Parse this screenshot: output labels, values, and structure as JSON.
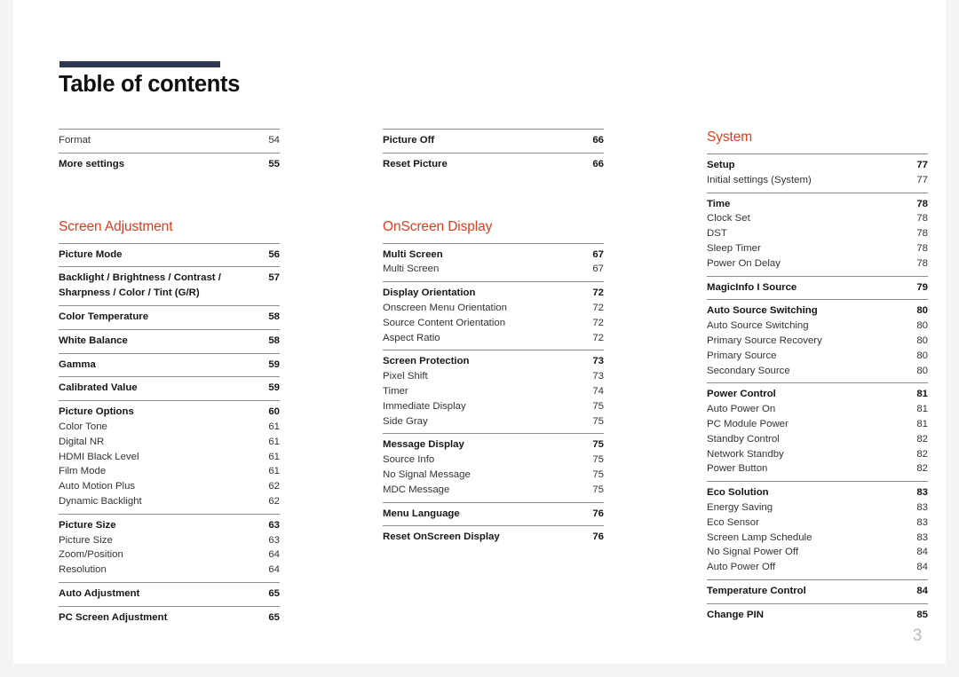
{
  "document": {
    "title": "Table of contents",
    "page_number": "3",
    "accent_color": "#dd3c1d",
    "rule_color": "#2e3852"
  },
  "columns": [
    {
      "name": "column-1",
      "groups": [
        {
          "heading": null,
          "entries": [
            {
              "label": "Format",
              "page": "54",
              "level": "minor"
            }
          ]
        },
        {
          "heading": null,
          "entries": [
            {
              "label": "More settings",
              "page": "55",
              "level": "major"
            }
          ]
        },
        {
          "heading": "Screen Adjustment",
          "entries": [
            {
              "label": "Picture Mode",
              "page": "56",
              "level": "major"
            }
          ]
        },
        {
          "heading": null,
          "entries": [
            {
              "label": "Backlight / Brightness / Contrast / Sharpness / Color / Tint (G/R)",
              "page": "57",
              "level": "major",
              "wrapped": true
            }
          ]
        },
        {
          "heading": null,
          "entries": [
            {
              "label": "Color Temperature",
              "page": "58",
              "level": "major"
            }
          ]
        },
        {
          "heading": null,
          "entries": [
            {
              "label": "White Balance",
              "page": "58",
              "level": "major"
            }
          ]
        },
        {
          "heading": null,
          "entries": [
            {
              "label": "Gamma",
              "page": "59",
              "level": "major"
            }
          ]
        },
        {
          "heading": null,
          "entries": [
            {
              "label": "Calibrated Value",
              "page": "59",
              "level": "major"
            }
          ]
        },
        {
          "heading": null,
          "entries": [
            {
              "label": "Picture Options",
              "page": "60",
              "level": "major"
            },
            {
              "label": "Color Tone",
              "page": "61",
              "level": "minor"
            },
            {
              "label": "Digital NR",
              "page": "61",
              "level": "minor"
            },
            {
              "label": "HDMI Black Level",
              "page": "61",
              "level": "minor"
            },
            {
              "label": "Film Mode",
              "page": "61",
              "level": "minor"
            },
            {
              "label": "Auto Motion Plus",
              "page": "62",
              "level": "minor"
            },
            {
              "label": "Dynamic Backlight",
              "page": "62",
              "level": "minor"
            }
          ]
        },
        {
          "heading": null,
          "entries": [
            {
              "label": "Picture Size",
              "page": "63",
              "level": "major"
            },
            {
              "label": "Picture Size",
              "page": "63",
              "level": "minor"
            },
            {
              "label": "Zoom/Position",
              "page": "64",
              "level": "minor"
            },
            {
              "label": "Resolution",
              "page": "64",
              "level": "minor"
            }
          ]
        },
        {
          "heading": null,
          "entries": [
            {
              "label": "Auto Adjustment",
              "page": "65",
              "level": "major"
            }
          ]
        },
        {
          "heading": null,
          "entries": [
            {
              "label": "PC Screen Adjustment",
              "page": "65",
              "level": "major"
            }
          ]
        }
      ]
    },
    {
      "name": "column-2",
      "groups": [
        {
          "heading": null,
          "entries": [
            {
              "label": "Picture Off",
              "page": "66",
              "level": "major"
            }
          ]
        },
        {
          "heading": null,
          "entries": [
            {
              "label": "Reset Picture",
              "page": "66",
              "level": "major"
            }
          ]
        },
        {
          "heading": "OnScreen Display",
          "entries": [
            {
              "label": "Multi Screen",
              "page": "67",
              "level": "major"
            },
            {
              "label": "Multi Screen",
              "page": "67",
              "level": "minor"
            }
          ]
        },
        {
          "heading": null,
          "entries": [
            {
              "label": "Display Orientation",
              "page": "72",
              "level": "major"
            },
            {
              "label": "Onscreen Menu Orientation",
              "page": "72",
              "level": "minor"
            },
            {
              "label": "Source Content Orientation",
              "page": "72",
              "level": "minor"
            },
            {
              "label": "Aspect Ratio",
              "page": "72",
              "level": "minor"
            }
          ]
        },
        {
          "heading": null,
          "entries": [
            {
              "label": "Screen Protection",
              "page": "73",
              "level": "major"
            },
            {
              "label": "Pixel Shift",
              "page": "73",
              "level": "minor"
            },
            {
              "label": "Timer",
              "page": "74",
              "level": "minor"
            },
            {
              "label": "Immediate Display",
              "page": "75",
              "level": "minor"
            },
            {
              "label": "Side Gray",
              "page": "75",
              "level": "minor"
            }
          ]
        },
        {
          "heading": null,
          "entries": [
            {
              "label": "Message Display",
              "page": "75",
              "level": "major"
            },
            {
              "label": "Source Info",
              "page": "75",
              "level": "minor"
            },
            {
              "label": "No Signal Message",
              "page": "75",
              "level": "minor"
            },
            {
              "label": "MDC Message",
              "page": "75",
              "level": "minor"
            }
          ]
        },
        {
          "heading": null,
          "entries": [
            {
              "label": "Menu Language",
              "page": "76",
              "level": "major"
            }
          ]
        },
        {
          "heading": null,
          "entries": [
            {
              "label": "Reset OnScreen Display",
              "page": "76",
              "level": "major"
            }
          ]
        }
      ]
    },
    {
      "name": "column-3",
      "groups": [
        {
          "heading": "System",
          "entries": [
            {
              "label": "Setup",
              "page": "77",
              "level": "major"
            },
            {
              "label": "Initial settings (System)",
              "page": "77",
              "level": "minor"
            }
          ]
        },
        {
          "heading": null,
          "entries": [
            {
              "label": "Time",
              "page": "78",
              "level": "major"
            },
            {
              "label": "Clock Set",
              "page": "78",
              "level": "minor"
            },
            {
              "label": "DST",
              "page": "78",
              "level": "minor"
            },
            {
              "label": "Sleep Timer",
              "page": "78",
              "level": "minor"
            },
            {
              "label": "Power On Delay",
              "page": "78",
              "level": "minor"
            }
          ]
        },
        {
          "heading": null,
          "entries": [
            {
              "label": "MagicInfo I Source",
              "page": "79",
              "level": "major"
            }
          ]
        },
        {
          "heading": null,
          "entries": [
            {
              "label": "Auto Source Switching",
              "page": "80",
              "level": "major"
            },
            {
              "label": "Auto Source Switching",
              "page": "80",
              "level": "minor"
            },
            {
              "label": "Primary Source Recovery",
              "page": "80",
              "level": "minor"
            },
            {
              "label": "Primary Source",
              "page": "80",
              "level": "minor"
            },
            {
              "label": "Secondary Source",
              "page": "80",
              "level": "minor"
            }
          ]
        },
        {
          "heading": null,
          "entries": [
            {
              "label": "Power Control",
              "page": "81",
              "level": "major"
            },
            {
              "label": "Auto Power On",
              "page": "81",
              "level": "minor"
            },
            {
              "label": "PC Module Power",
              "page": "81",
              "level": "minor"
            },
            {
              "label": "Standby Control",
              "page": "82",
              "level": "minor"
            },
            {
              "label": "Network Standby",
              "page": "82",
              "level": "minor"
            },
            {
              "label": "Power Button",
              "page": "82",
              "level": "minor"
            }
          ]
        },
        {
          "heading": null,
          "entries": [
            {
              "label": "Eco Solution",
              "page": "83",
              "level": "major"
            },
            {
              "label": "Energy Saving",
              "page": "83",
              "level": "minor"
            },
            {
              "label": "Eco Sensor",
              "page": "83",
              "level": "minor"
            },
            {
              "label": "Screen Lamp Schedule",
              "page": "83",
              "level": "minor"
            },
            {
              "label": "No Signal Power Off",
              "page": "84",
              "level": "minor"
            },
            {
              "label": "Auto Power Off",
              "page": "84",
              "level": "minor"
            }
          ]
        },
        {
          "heading": null,
          "entries": [
            {
              "label": "Temperature Control",
              "page": "84",
              "level": "major"
            }
          ]
        },
        {
          "heading": null,
          "entries": [
            {
              "label": "Change PIN",
              "page": "85",
              "level": "major"
            }
          ]
        }
      ]
    }
  ]
}
